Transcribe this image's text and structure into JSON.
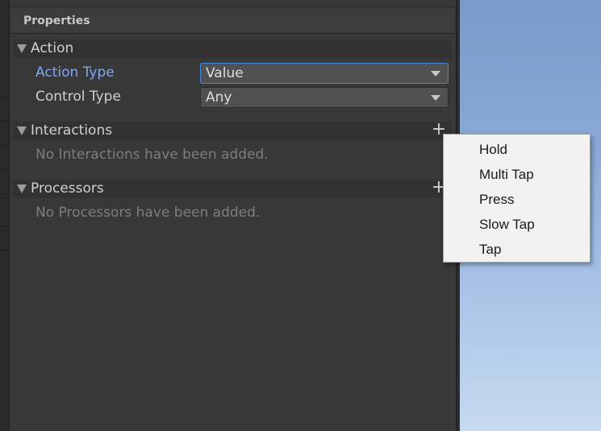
{
  "header": {
    "title": "Properties"
  },
  "action": {
    "title": "Action",
    "action_type_label": "Action Type",
    "action_type_value": "Value",
    "control_type_label": "Control Type",
    "control_type_value": "Any"
  },
  "interactions": {
    "title": "Interactions",
    "add_symbol": "+",
    "empty_text": "No Interactions have been added."
  },
  "processors": {
    "title": "Processors",
    "add_symbol": "+",
    "empty_text": "No Processors have been added."
  },
  "popup_menu": {
    "items": [
      {
        "label": "Hold"
      },
      {
        "label": "Multi Tap"
      },
      {
        "label": "Press"
      },
      {
        "label": "Slow Tap"
      },
      {
        "label": "Tap"
      }
    ]
  },
  "colors": {
    "panel_bg": "#383838",
    "focus_accent": "#3f8ae0",
    "active_label": "#7fa9ef",
    "menu_bg": "#f2f2f2"
  }
}
